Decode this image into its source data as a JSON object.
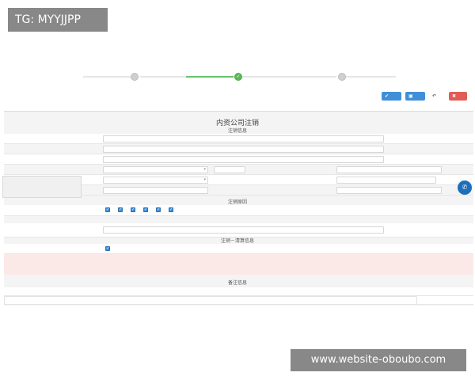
{
  "watermarks": {
    "top": "TG: MYYJJPP",
    "bottom": "www.website-oboubo.com"
  },
  "steps": [
    {
      "label": "",
      "state": "done"
    },
    {
      "label": "",
      "state": "active"
    },
    {
      "label": "",
      "state": "pending"
    }
  ],
  "toolbar": {
    "save_label": "",
    "save2_label": "",
    "back_label": "",
    "delete_label": ""
  },
  "breadcrumb": {
    "item1": "",
    "item2": ""
  },
  "form": {
    "title": "内资公司注销",
    "sections": {
      "cancel_info": "注销信息",
      "cancel_reason": "注销原因",
      "liquidation": "注销－清算信息",
      "remarks": "备注信息"
    },
    "fields": {
      "company_name": {
        "label": "",
        "value": ""
      },
      "address": {
        "label": "",
        "value": ""
      },
      "legal_rep": {
        "label": "",
        "value": ""
      },
      "id_type": {
        "label": "",
        "value": ""
      },
      "id_number": {
        "label": "",
        "value": ""
      },
      "company_type": {
        "label": "",
        "value": ""
      },
      "registered_capital": {
        "label": "",
        "value": ""
      },
      "capital_unit": "",
      "business_term": {
        "label": "",
        "value": ""
      },
      "employee_count": {
        "label": "",
        "value": ""
      },
      "reason_label": "",
      "reason_other_label": "",
      "reason_other_value": "",
      "cancel_method_label": "",
      "cancel_method_value": "",
      "approval_label": "",
      "approval_value": "",
      "remark_label": "",
      "remark_value": ""
    },
    "reason_options": [
      "",
      "",
      "",
      "",
      "",
      "",
      ""
    ],
    "warnings": [
      "",
      ""
    ]
  },
  "help": {
    "tip": "",
    "service_label": ""
  }
}
